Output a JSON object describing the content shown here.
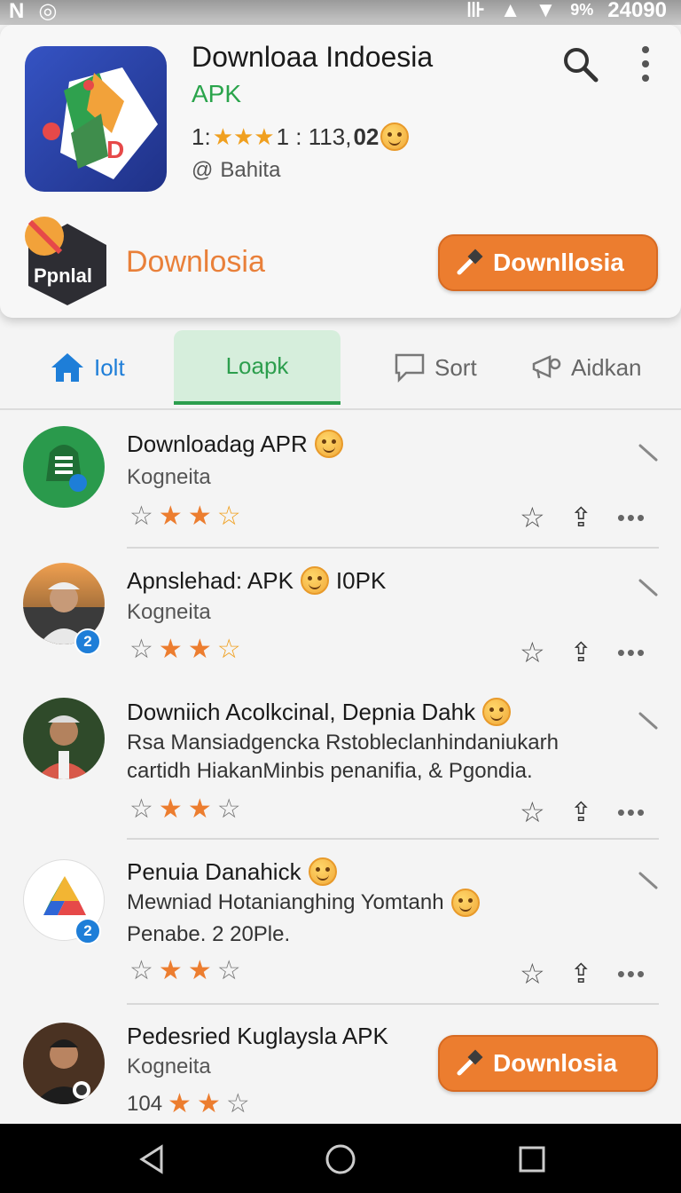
{
  "status_bar": {
    "left": [
      "N",
      "◎"
    ],
    "battery": "9%",
    "time": "24090"
  },
  "app": {
    "title": "Downloaa Indoesia",
    "subtitle": "APK",
    "rating_prefix": "1:",
    "rating_mid": "1 :  113, ",
    "rating_bold": "02",
    "developer": "Bahita",
    "promo_badge": "Ppnlal",
    "promo_text": "Downlosia",
    "download_label": "Downllosia"
  },
  "tabs": [
    {
      "label": "Iolt",
      "icon": "home-icon"
    },
    {
      "label": "Loapk",
      "icon": ""
    },
    {
      "label": "Sort",
      "icon": "message-icon"
    },
    {
      "label": "Aidkan",
      "icon": "megaphone-icon"
    }
  ],
  "list": [
    {
      "title": "Downloadag APR",
      "subtitle": "Kogneita",
      "stars": 3
    },
    {
      "title": "Apnslehad: APK",
      "title_suffix": "I0PK",
      "subtitle": "Kogneita",
      "stars": 3,
      "badge": "2"
    },
    {
      "title": "Downiich Acolkcinal, Depnia Dahk",
      "desc1": "Rsa Mansiadgencka Rstobleclanhindaniukarh",
      "desc2": "cartidh HiakanMinbis penanifia, & Pgondia.",
      "stars": 3
    },
    {
      "title": "Penuia Danahick",
      "desc1": "Mewniad Hotanianghing Yomtanh",
      "desc2": "Penabe. 2 20Ple.",
      "stars": 3,
      "badge": "2"
    },
    {
      "title": "Pedesried Kuglaysla APK",
      "subtitle": "Kogneita",
      "rating_text": "104",
      "stars": 2,
      "button": "Downlosia"
    }
  ],
  "colors": {
    "accent": "#ec7d2f",
    "green": "#2c9e4d",
    "blue": "#1e7ed8",
    "star": "#ec7d2f"
  }
}
